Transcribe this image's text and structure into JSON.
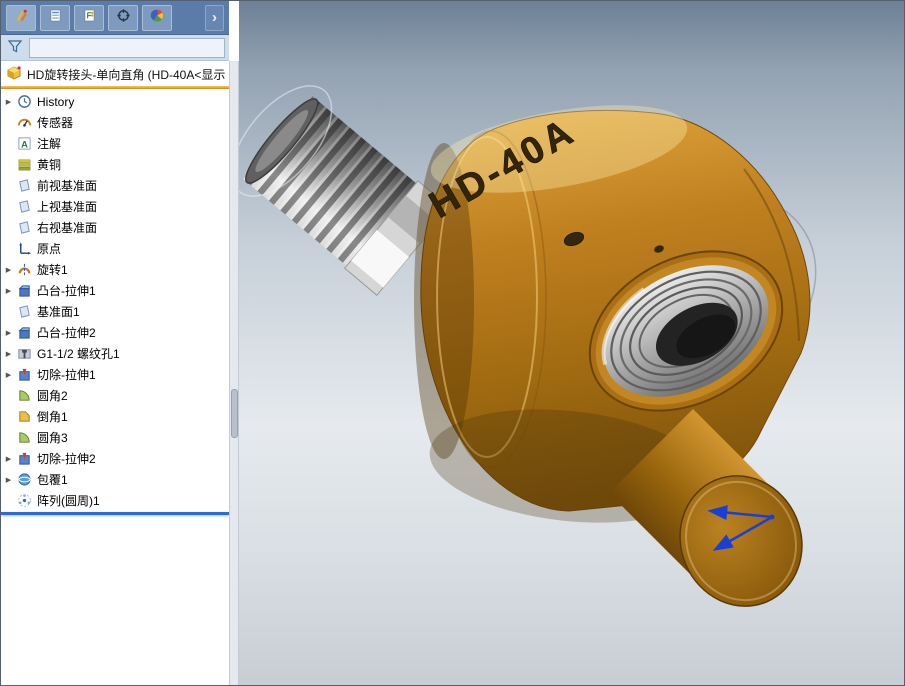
{
  "colors": {
    "accent_freeze": "#e8a33d",
    "accent_rollback": "#2f6bd7",
    "part_light": "#e2a93e",
    "part_mid": "#c08020",
    "part_dark": "#7f540c",
    "thread_light": "#efefef",
    "thread_dark": "#565656",
    "triad_blue": "#1b3fd4",
    "viewport_top": "#6d8096",
    "viewport_bottom": "#c7cdd3",
    "tabstrip_bg": "#5b7ca8",
    "filter_bg": "#cfdcec"
  },
  "icons": {
    "expand_arrow": "▶",
    "overflow_chevron": "›"
  },
  "panel_tabs": [
    {
      "name": "featuremanager-tab"
    },
    {
      "name": "propertymanager-tab"
    },
    {
      "name": "configurationmanager-tab"
    },
    {
      "name": "dimxpertmanager-tab"
    },
    {
      "name": "displaymanager-tab"
    }
  ],
  "filter": {
    "value": ""
  },
  "feature_tree": {
    "root": {
      "label": "HD旋转接头-单向直角 (HD-40A<显示"
    },
    "items": [
      {
        "label": "History",
        "icon": "history",
        "expandable": true
      },
      {
        "label": "传感器",
        "icon": "sensors",
        "expandable": false
      },
      {
        "label": "注解",
        "icon": "annotations",
        "expandable": false
      },
      {
        "label": "黄铜",
        "icon": "material",
        "expandable": false
      },
      {
        "label": "前视基准面",
        "icon": "plane",
        "expandable": false
      },
      {
        "label": "上视基准面",
        "icon": "plane",
        "expandable": false
      },
      {
        "label": "右视基准面",
        "icon": "plane",
        "expandable": false
      },
      {
        "label": "原点",
        "icon": "origin",
        "expandable": false
      },
      {
        "label": "旋转1",
        "icon": "revolve",
        "expandable": true
      },
      {
        "label": "凸台-拉伸1",
        "icon": "boss-extrude",
        "expandable": true
      },
      {
        "label": "基准面1",
        "icon": "plane",
        "expandable": false
      },
      {
        "label": "凸台-拉伸2",
        "icon": "boss-extrude",
        "expandable": true
      },
      {
        "label": "G1-1/2 螺纹孔1",
        "icon": "hole-wizard",
        "expandable": true
      },
      {
        "label": "切除-拉伸1",
        "icon": "cut-extrude",
        "expandable": true
      },
      {
        "label": "圆角2",
        "icon": "fillet",
        "expandable": false
      },
      {
        "label": "倒角1",
        "icon": "chamfer",
        "expandable": false
      },
      {
        "label": "圆角3",
        "icon": "fillet",
        "expandable": false
      },
      {
        "label": "切除-拉伸2",
        "icon": "cut-extrude",
        "expandable": true
      },
      {
        "label": "包覆1",
        "icon": "wrap",
        "expandable": true
      },
      {
        "label": "阵列(圆周)1",
        "icon": "circular-pattern",
        "expandable": false
      }
    ]
  },
  "model": {
    "label": "HD-40A"
  }
}
